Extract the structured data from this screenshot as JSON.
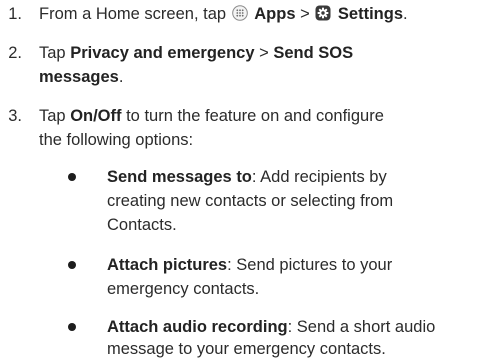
{
  "steps": [
    {
      "number": "1.",
      "pre": "From a Home screen, tap ",
      "apps_label": "Apps",
      "separator": " > ",
      "settings_label": "Settings",
      "end": "."
    },
    {
      "number": "2.",
      "pre": "Tap ",
      "strong_a": "Privacy and emergency",
      "separator": " > ",
      "strong_b_line1": "Send SOS",
      "strong_b_line2": "messages",
      "end": "."
    },
    {
      "number": "3.",
      "pre": "Tap ",
      "strong": "On/Off",
      "rest_line1": " to turn the feature on and configure",
      "rest_line2": "the following options:"
    }
  ],
  "options": [
    {
      "term": "Send messages to",
      "line1": ": Add recipients by",
      "line2": "creating new contacts or selecting from",
      "line3": "Contacts."
    },
    {
      "term": "Attach pictures",
      "line1": ": Send pictures to your",
      "line2": "emergency contacts."
    },
    {
      "term": "Attach audio recording",
      "line1": ": Send a short audio",
      "line2": "message to your emergency contacts."
    }
  ],
  "icons": {
    "apps": "apps-grid-icon",
    "settings": "settings-gear-icon"
  }
}
